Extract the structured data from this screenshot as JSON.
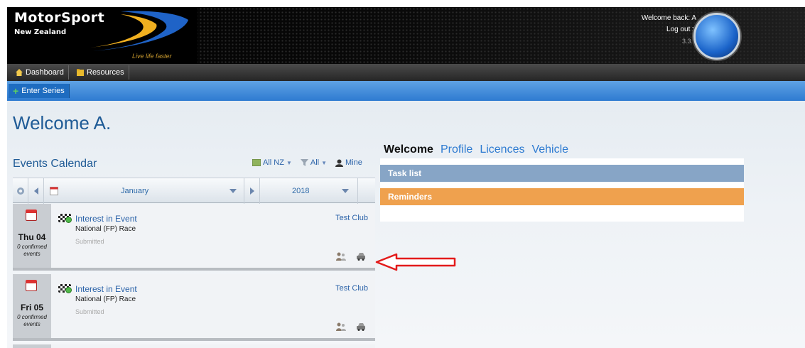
{
  "header": {
    "logo_title": "MotorSport",
    "logo_sub": "New Zealand",
    "logo_tagline": "Live life faster",
    "welcome": "Welcome back: A",
    "logout": "Log out >",
    "version": "3.3.6"
  },
  "menu": {
    "dashboard": "Dashboard",
    "resources": "Resources"
  },
  "toolbar": {
    "enter_series": "Enter Series"
  },
  "page": {
    "title": "Welcome A."
  },
  "calendar": {
    "title": "Events Calendar",
    "filter_region": "All NZ",
    "filter_type": "All",
    "filter_mine": "Mine",
    "month": "January",
    "year": "2018",
    "events": [
      {
        "day": "Thu 04",
        "confirmed": "0 confirmed events",
        "title": "Interest in Event",
        "subtitle": "National (FP) Race",
        "status": "Submitted",
        "club": "Test Club"
      },
      {
        "day": "Fri 05",
        "confirmed": "0 confirmed events",
        "title": "Interest in Event",
        "subtitle": "National (FP) Race",
        "status": "Submitted",
        "club": "Test Club"
      }
    ]
  },
  "right_panel": {
    "tabs": [
      "Welcome",
      "Profile",
      "Licences",
      "Vehicle"
    ],
    "task_list": "Task list",
    "reminders": "Reminders"
  },
  "colors": {
    "brand_blue": "#2e7bd1",
    "task_bar": "#87a5c6",
    "reminder_bar": "#efa14e",
    "annotation_arrow": "#e31b1b"
  }
}
